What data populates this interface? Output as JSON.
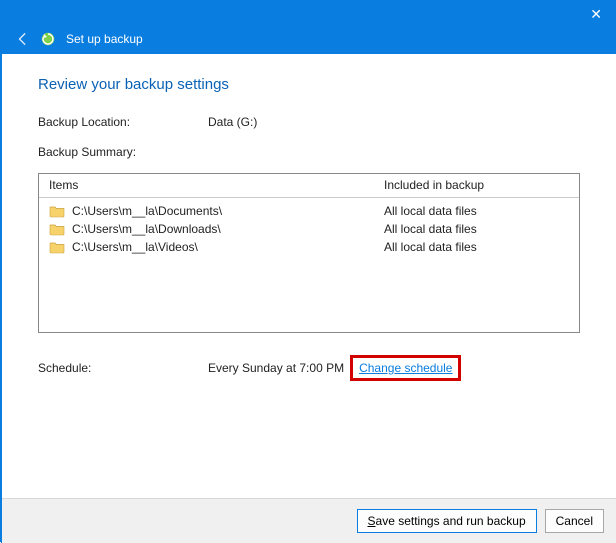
{
  "window": {
    "title": "Set up backup"
  },
  "heading": "Review your backup settings",
  "backup_location": {
    "label": "Backup Location:",
    "value": "Data (G:)"
  },
  "backup_summary": {
    "label": "Backup Summary:",
    "columns": {
      "items": "Items",
      "included": "Included in backup"
    },
    "rows": [
      {
        "path": "C:\\Users\\m__la\\Documents\\",
        "included": "All local data files"
      },
      {
        "path": "C:\\Users\\m__la\\Downloads\\",
        "included": "All local data files"
      },
      {
        "path": "C:\\Users\\m__la\\Videos\\",
        "included": "All local data files"
      }
    ]
  },
  "schedule": {
    "label": "Schedule:",
    "value": "Every Sunday at 7:00 PM",
    "link": "Change schedule"
  },
  "footer": {
    "save": {
      "ul": "S",
      "rest": "ave settings and run backup"
    },
    "cancel": "Cancel"
  }
}
